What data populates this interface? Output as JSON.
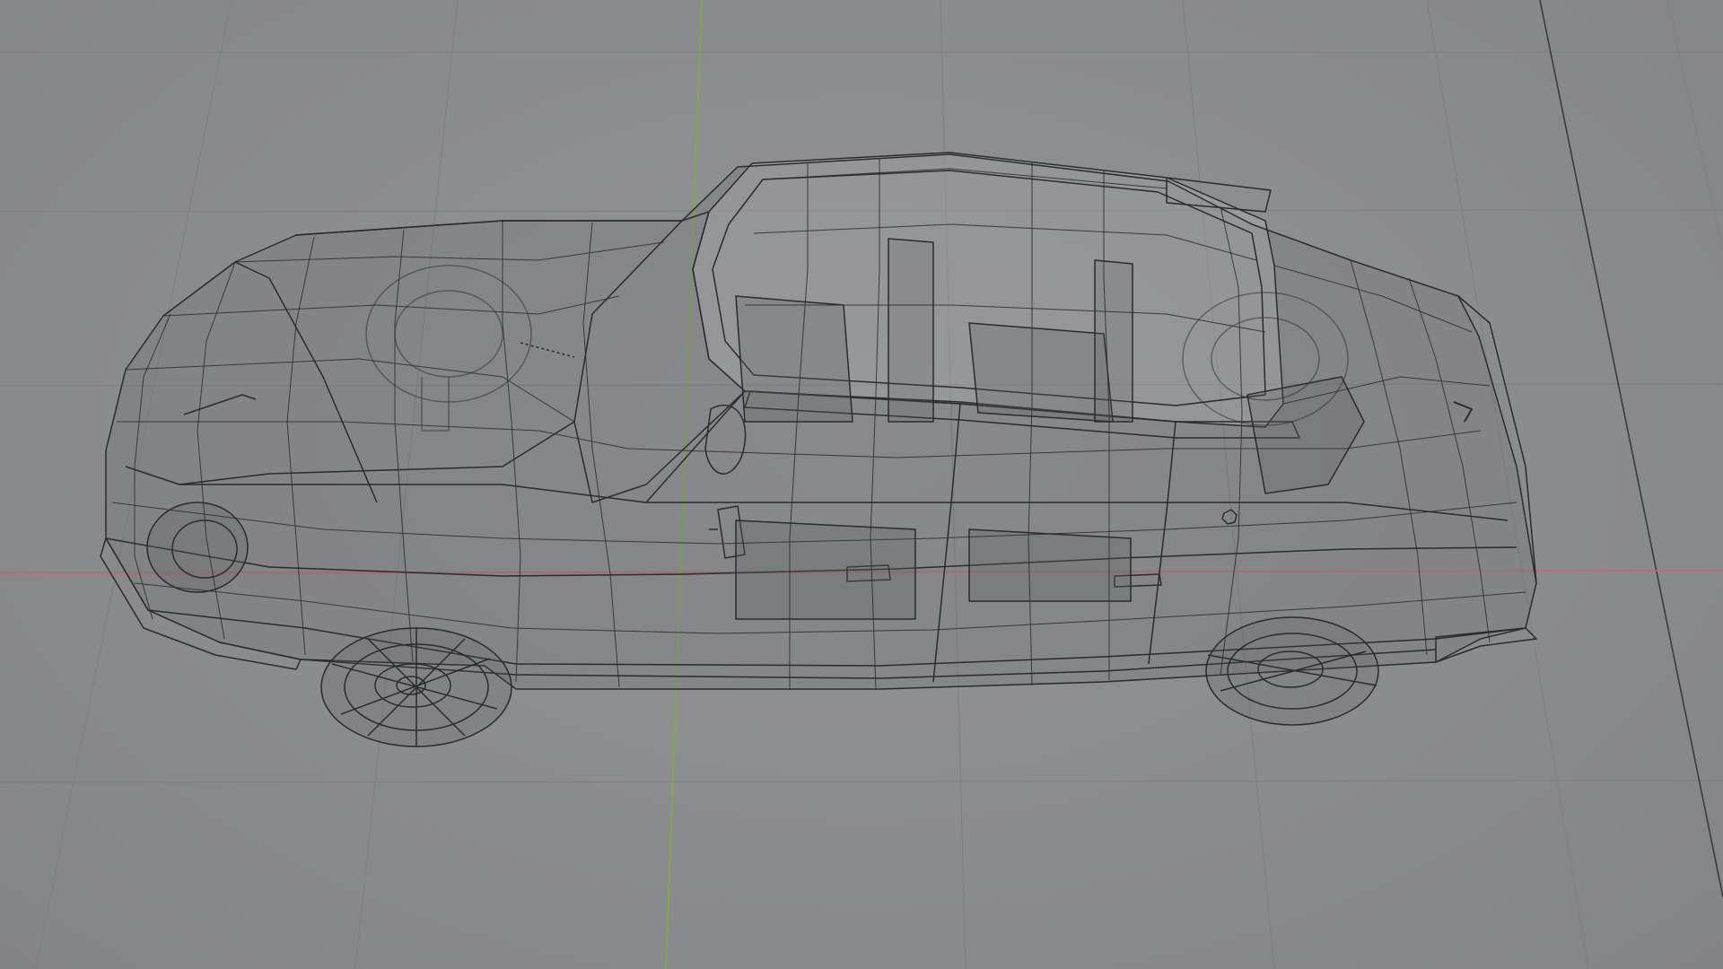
{
  "viewport": {
    "mode": "wireframe",
    "view": "user-perspective",
    "background_color": "#8b8c8e",
    "grid_color": "#7f8082",
    "axis_x_color": "#c8686e",
    "axis_y_color": "#7fae3e",
    "wire_color": "#2a2b2d",
    "object": {
      "name": "car-wireframe-model",
      "wheels_visible": 4,
      "seats_visible": 4
    }
  }
}
